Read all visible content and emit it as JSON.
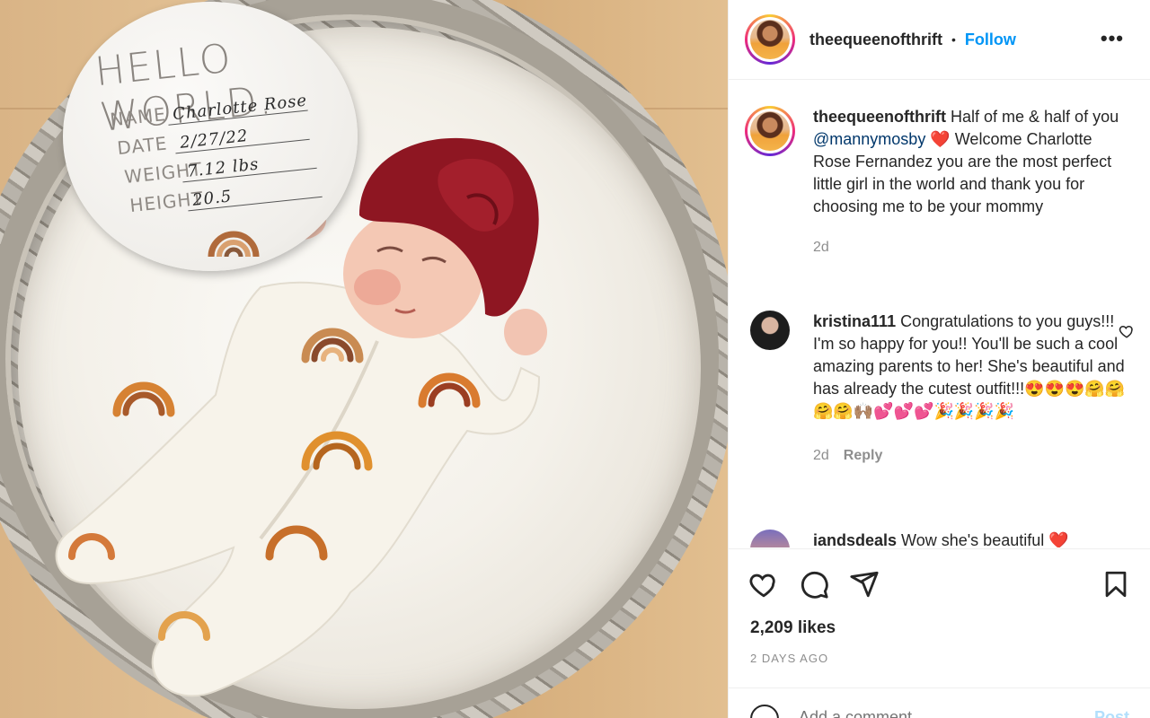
{
  "post": {
    "username": "theequeenofthrift",
    "follow_label": "Follow",
    "more_label": "•••",
    "dot": "•",
    "caption_user": "theequeenofthrift",
    "caption_pre": " Half of me & half of you ",
    "caption_mention": "@mannymosby",
    "caption_heart": "❤️",
    "caption_post": " Welcome Charlotte Rose Fernandez you are the most perfect little girl in the world and thank you for choosing me to be your mommy",
    "caption_time": "2d",
    "likes": "2,209 likes",
    "time_ago": "2 DAYS AGO",
    "add_comment_placeholder": "Add a comment...",
    "post_label": "Post"
  },
  "comments": [
    {
      "user": "kristina111",
      "text": " Congratulations to you guys!!! I'm so happy for you!! You'll be such a cool amazing parents to her! She's beautiful and has already the cutest outfit!!!😍😍😍🤗🤗🤗🤗🙌🏽💕💕💕🎉🎉🎉🎉",
      "time": "2d",
      "reply_label": "Reply"
    },
    {
      "user": "iandsdeals",
      "text": " Wow she's beautiful ❤️"
    }
  ],
  "sign": {
    "title": "HELLO WORLD.",
    "name_label": "NAME",
    "name_value": "Charlotte Rose",
    "date_label": "DATE",
    "date_value": "2/27/22",
    "weight_label": "WEIGHT",
    "weight_value": "7.12 lbs",
    "height_label": "HEIGHT",
    "height_value": "20.5"
  },
  "icons": {
    "like": "heart-icon",
    "comment": "comment-icon",
    "share": "send-icon",
    "save": "bookmark-icon",
    "emoji": "emoji-icon",
    "more": "more-icon"
  },
  "colors": {
    "link_blue": "#0095f6",
    "mention": "#00376b",
    "text": "#262626",
    "muted": "#8e8e8e",
    "border": "#efefef",
    "post_disabled": "#b2dffc"
  }
}
